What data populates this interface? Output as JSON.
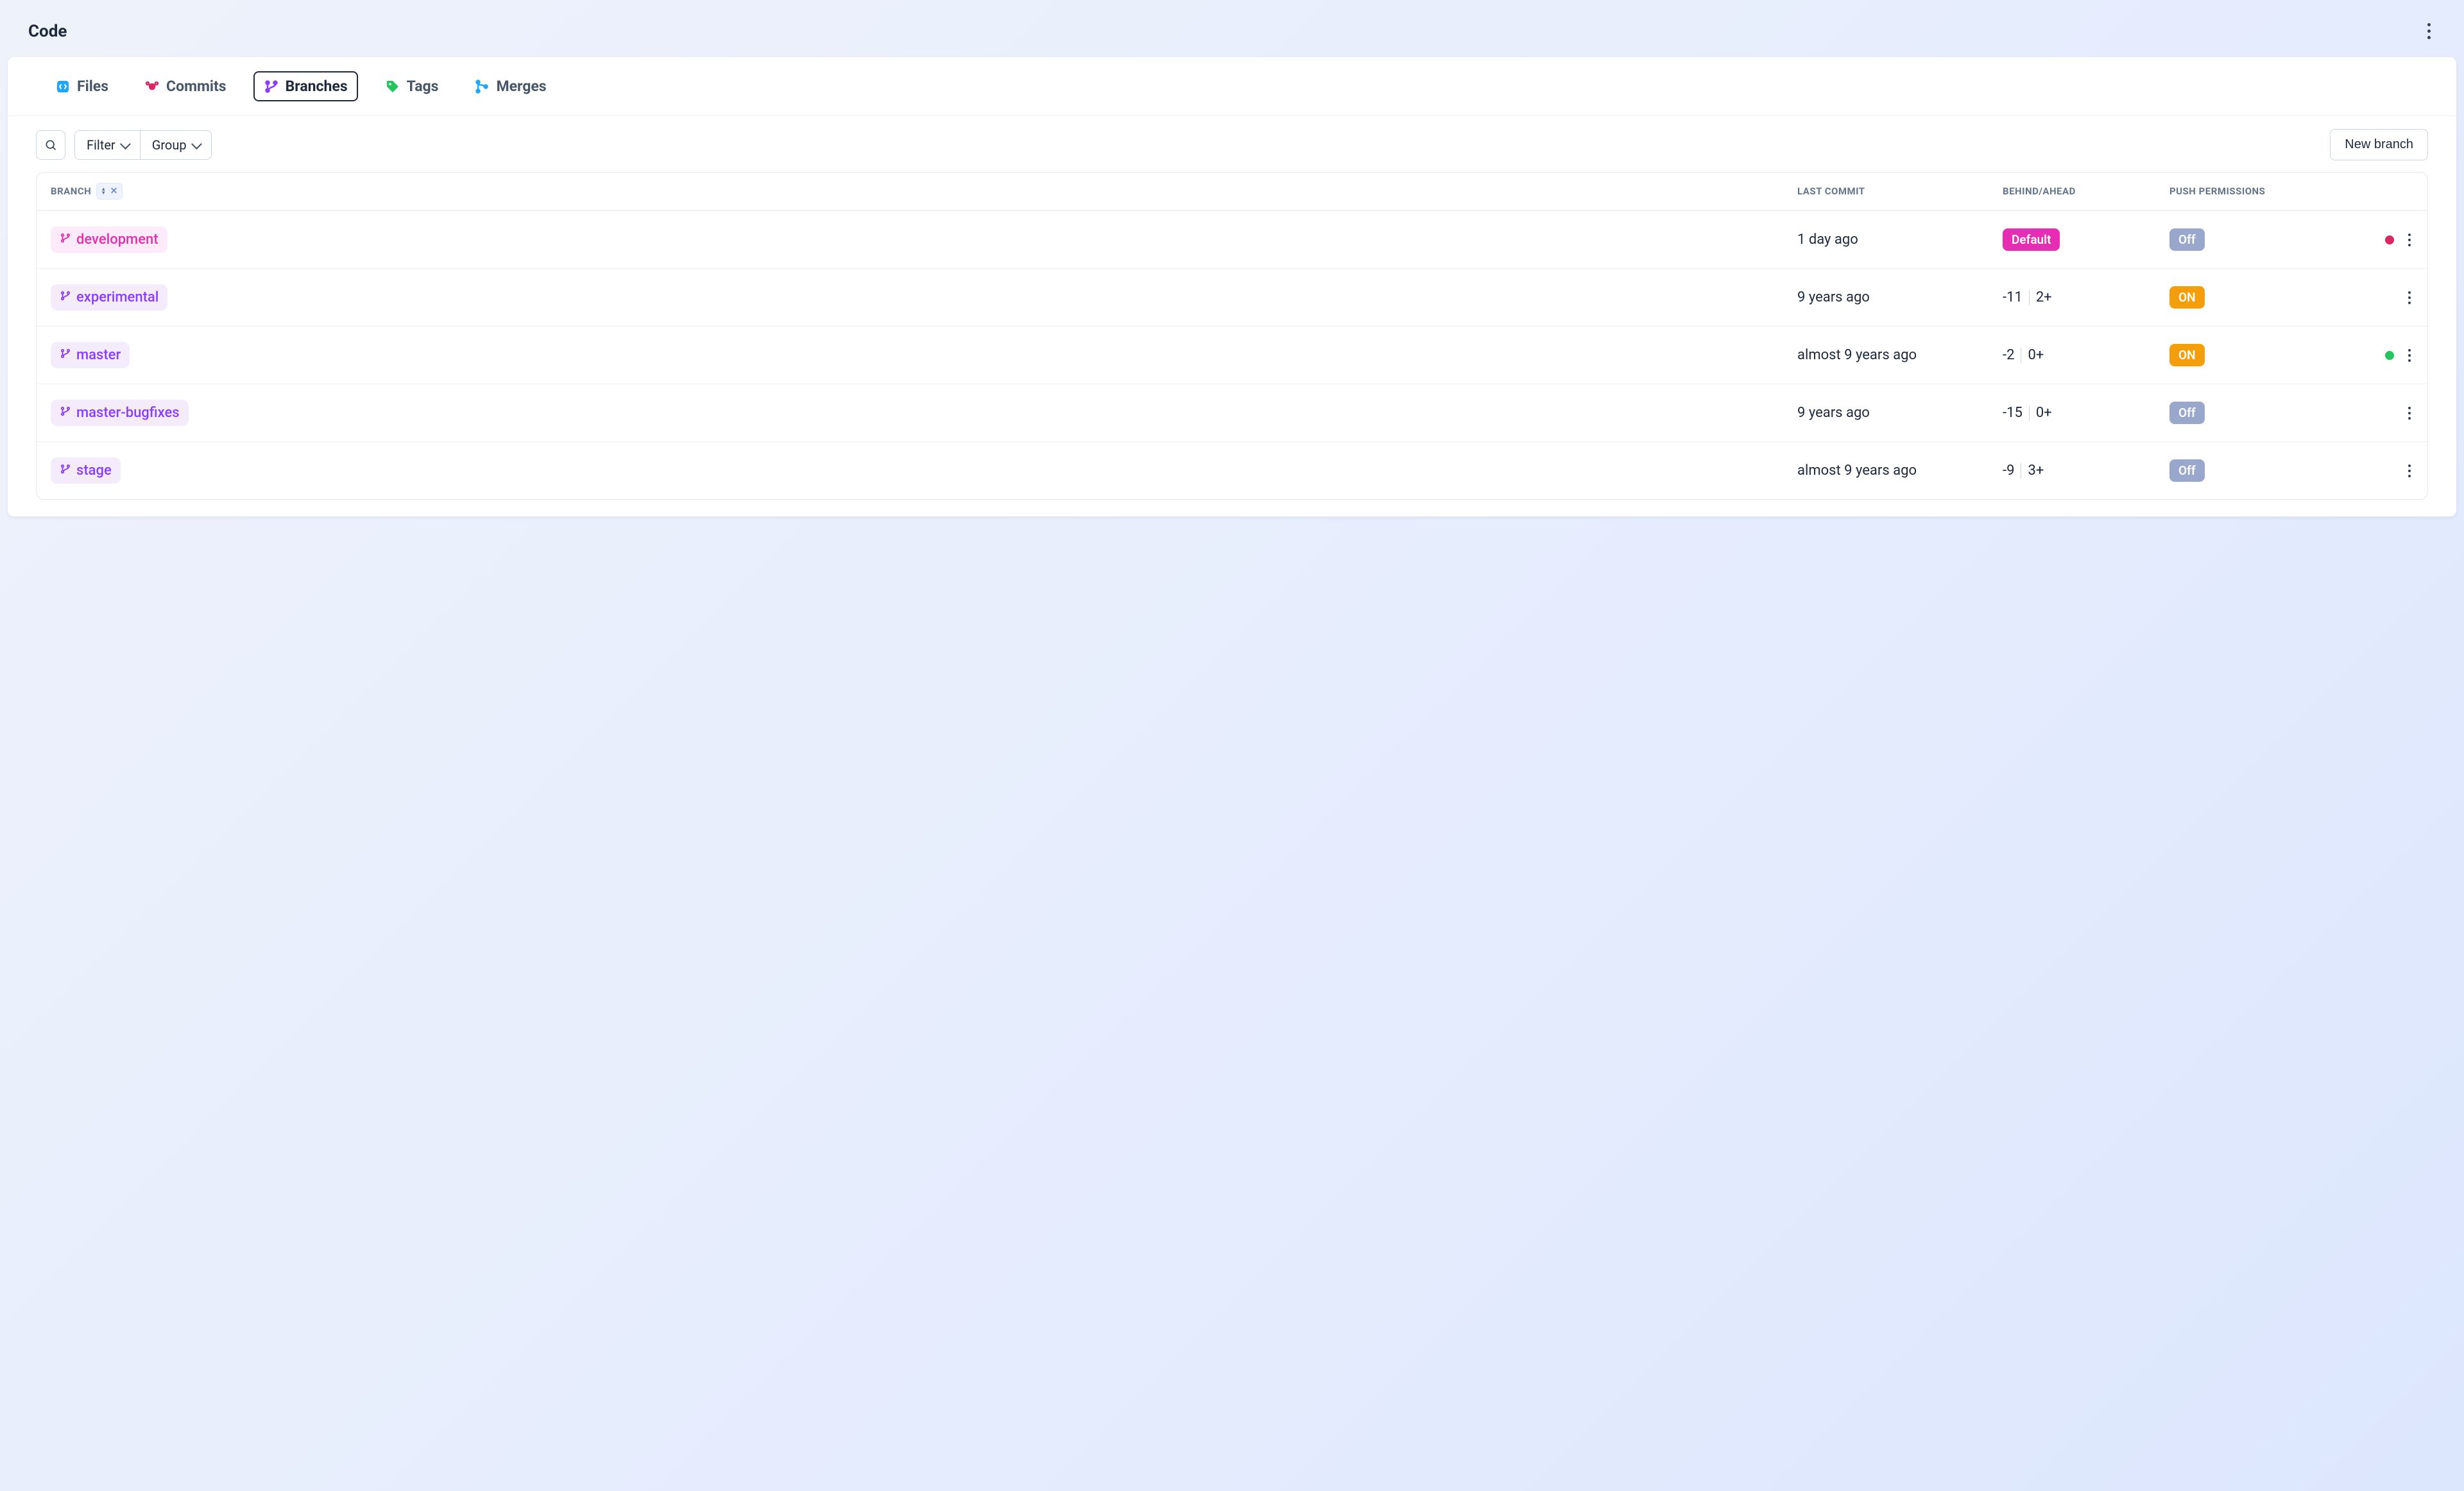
{
  "header": {
    "title": "Code"
  },
  "tabs": {
    "items": [
      {
        "label": "Files",
        "icon": "code-file-icon",
        "icon_color": "#1ea7ff"
      },
      {
        "label": "Commits",
        "icon": "commit-icon",
        "icon_color": "#dc2662"
      },
      {
        "label": "Branches",
        "icon": "branch-icon",
        "icon_color": "#8b3dff"
      },
      {
        "label": "Tags",
        "icon": "tag-icon",
        "icon_color": "#22c55e"
      },
      {
        "label": "Merges",
        "icon": "merge-icon",
        "icon_color": "#1ea7ff"
      }
    ],
    "active_index": 2
  },
  "toolbar": {
    "filter_label": "Filter",
    "group_label": "Group",
    "new_branch_label": "New branch"
  },
  "table": {
    "columns": {
      "branch": "BRANCH",
      "last_commit": "LAST COMMIT",
      "behind_ahead": "BEHIND/AHEAD",
      "push_permissions": "PUSH PERMISSIONS"
    },
    "rows": [
      {
        "name": "development",
        "chip_style": "pink",
        "last_commit": "1 day ago",
        "behind_ahead_text": "Default",
        "behind_ahead_is_default": true,
        "push": "Off",
        "push_style": "off",
        "status_dot": "red"
      },
      {
        "name": "experimental",
        "chip_style": "purple",
        "last_commit": "9 years ago",
        "behind": "-11",
        "ahead": "2+",
        "behind_ahead_is_default": false,
        "push": "ON",
        "push_style": "on",
        "status_dot": null
      },
      {
        "name": "master",
        "chip_style": "purple",
        "last_commit": "almost 9 years ago",
        "behind": "-2",
        "ahead": "0+",
        "behind_ahead_is_default": false,
        "push": "ON",
        "push_style": "on",
        "status_dot": "green"
      },
      {
        "name": "master-bugfixes",
        "chip_style": "purple",
        "last_commit": "9 years ago",
        "behind": "-15",
        "ahead": "0+",
        "behind_ahead_is_default": false,
        "push": "Off",
        "push_style": "off",
        "status_dot": null
      },
      {
        "name": "stage",
        "chip_style": "purple",
        "last_commit": "almost 9 years ago",
        "behind": "-9",
        "ahead": "3+",
        "behind_ahead_is_default": false,
        "push": "Off",
        "push_style": "off",
        "status_dot": null
      }
    ]
  },
  "colors": {
    "accent_pink": "#e62db3",
    "accent_purple": "#8b3dff",
    "accent_orange": "#f59e0b",
    "muted_blue": "#9aa7cc"
  }
}
